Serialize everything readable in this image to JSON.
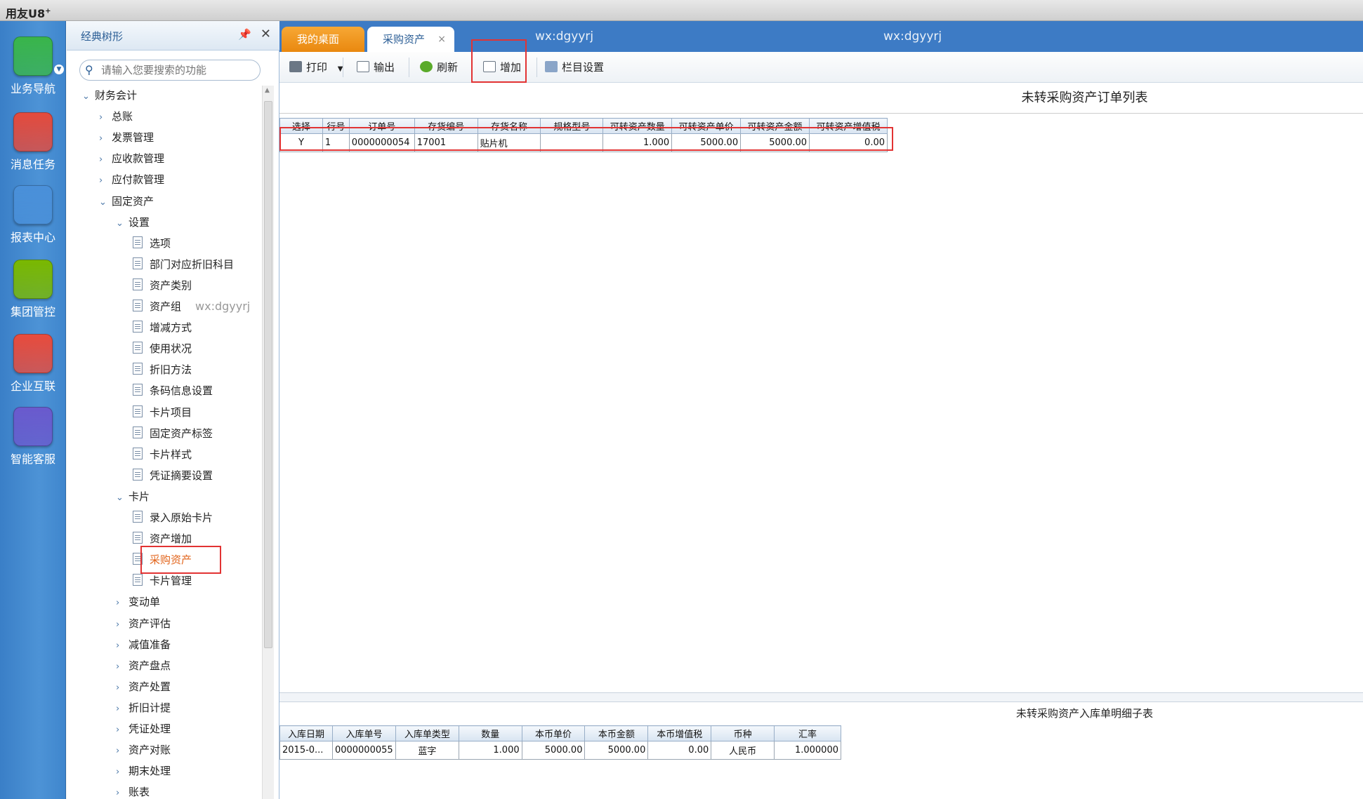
{
  "app": {
    "brand": "用友",
    "brand_suffix": "U8",
    "brand_sup": "+"
  },
  "rail": {
    "items": [
      {
        "label": "业务导航",
        "icon": "business-nav-icon",
        "color": "#39b54a"
      },
      {
        "label": "消息任务",
        "icon": "message-task-icon",
        "color": "#e44a3c"
      },
      {
        "label": "报表中心",
        "icon": "report-center-icon",
        "color": "#4a90d9"
      },
      {
        "label": "集团管控",
        "icon": "group-control-icon",
        "color": "#7ab800"
      },
      {
        "label": "企业互联",
        "icon": "enterprise-link-icon",
        "color": "#e84b3c"
      },
      {
        "label": "智能客服",
        "icon": "smart-service-icon",
        "color": "#6a5acd"
      }
    ]
  },
  "tree": {
    "title": "经典树形",
    "search_placeholder": "请输入您要搜索的功能",
    "items": [
      {
        "label": "财务会计",
        "level": 0,
        "arrow": "down"
      },
      {
        "label": "总账",
        "level": 1,
        "arrow": "right"
      },
      {
        "label": "发票管理",
        "level": 1,
        "arrow": "right"
      },
      {
        "label": "应收款管理",
        "level": 1,
        "arrow": "right"
      },
      {
        "label": "应付款管理",
        "level": 1,
        "arrow": "right"
      },
      {
        "label": "固定资产",
        "level": 1,
        "arrow": "down"
      },
      {
        "label": "设置",
        "level": 2,
        "arrow": "down"
      },
      {
        "label": "选项",
        "level": 3,
        "arrow": "doc"
      },
      {
        "label": "部门对应折旧科目",
        "level": 3,
        "arrow": "doc"
      },
      {
        "label": "资产类别",
        "level": 3,
        "arrow": "doc"
      },
      {
        "label": "资产组",
        "level": 3,
        "arrow": "doc"
      },
      {
        "label": "增减方式",
        "level": 3,
        "arrow": "doc"
      },
      {
        "label": "使用状况",
        "level": 3,
        "arrow": "doc"
      },
      {
        "label": "折旧方法",
        "level": 3,
        "arrow": "doc"
      },
      {
        "label": "条码信息设置",
        "level": 3,
        "arrow": "doc"
      },
      {
        "label": "卡片项目",
        "level": 3,
        "arrow": "doc"
      },
      {
        "label": "固定资产标签",
        "level": 3,
        "arrow": "doc"
      },
      {
        "label": "卡片样式",
        "level": 3,
        "arrow": "doc"
      },
      {
        "label": "凭证摘要设置",
        "level": 3,
        "arrow": "doc"
      },
      {
        "label": "卡片",
        "level": 2,
        "arrow": "down"
      },
      {
        "label": "录入原始卡片",
        "level": 3,
        "arrow": "doc"
      },
      {
        "label": "资产增加",
        "level": 3,
        "arrow": "doc"
      },
      {
        "label": "采购资产",
        "level": 3,
        "arrow": "doc",
        "selected": true
      },
      {
        "label": "卡片管理",
        "level": 3,
        "arrow": "doc"
      },
      {
        "label": "变动单",
        "level": 2,
        "arrow": "right"
      },
      {
        "label": "资产评估",
        "level": 2,
        "arrow": "right"
      },
      {
        "label": "减值准备",
        "level": 2,
        "arrow": "right"
      },
      {
        "label": "资产盘点",
        "level": 2,
        "arrow": "right"
      },
      {
        "label": "资产处置",
        "level": 2,
        "arrow": "right"
      },
      {
        "label": "折旧计提",
        "level": 2,
        "arrow": "right"
      },
      {
        "label": "凭证处理",
        "level": 2,
        "arrow": "right"
      },
      {
        "label": "资产对账",
        "level": 2,
        "arrow": "right"
      },
      {
        "label": "期末处理",
        "level": 2,
        "arrow": "right"
      },
      {
        "label": "账表",
        "level": 2,
        "arrow": "right"
      }
    ]
  },
  "watermark": {
    "text": "wx:dgyyrj"
  },
  "tabs": {
    "home": "我的桌面",
    "active": "采购资产",
    "close": "×"
  },
  "toolbar": {
    "print": "打印",
    "export": "输出",
    "refresh": "刷新",
    "add": "增加",
    "columns": "栏目设置"
  },
  "top_table": {
    "title": "未转采购资产订单列表",
    "columns": [
      "选择",
      "行号",
      "订单号",
      "存货编号",
      "存货名称",
      "规格型号",
      "可转资产数量",
      "可转资产单价",
      "可转资产金额",
      "可转资产增值税"
    ],
    "rows": [
      [
        "Y",
        "1",
        "0000000054",
        "17001",
        "贴片机",
        "",
        "1.000",
        "5000.00",
        "5000.00",
        "0.00"
      ]
    ]
  },
  "bottom_table": {
    "title": "未转采购资产入库单明细子表",
    "columns": [
      "入库日期",
      "入库单号",
      "入库单类型",
      "数量",
      "本币单价",
      "本币金额",
      "本币增值税",
      "币种",
      "汇率"
    ],
    "rows": [
      [
        "2015-0...",
        "0000000055",
        "蓝字",
        "1.000",
        "5000.00",
        "5000.00",
        "0.00",
        "人民币",
        "1.000000"
      ]
    ]
  },
  "colors": {
    "accent": "#3d7bc5",
    "home_tab": "#f7a835",
    "highlight": "#e23333",
    "selected_text": "#e2641b"
  }
}
